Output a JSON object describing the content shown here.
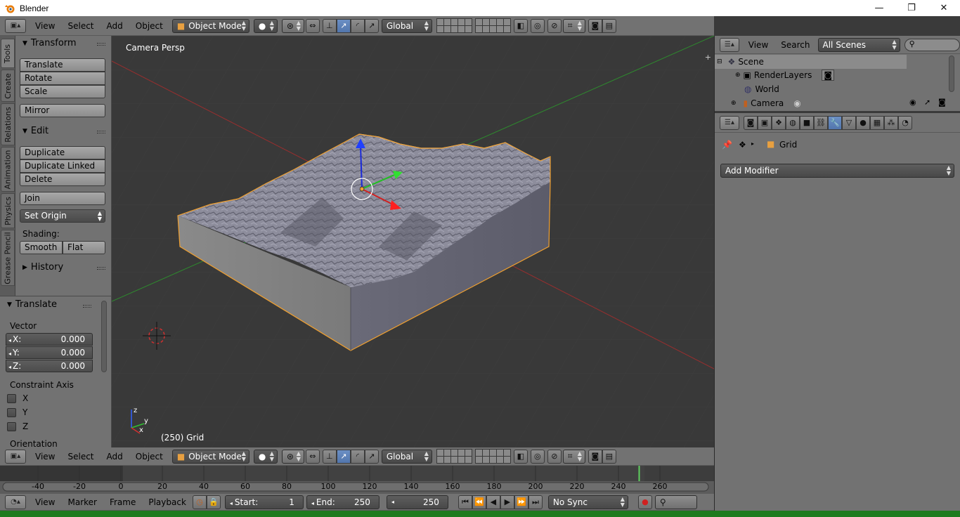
{
  "window": {
    "title": "Blender",
    "minimize": "—",
    "maximize": "❐",
    "close": "✕"
  },
  "top_header": {
    "menus": [
      "View",
      "Select",
      "Add",
      "Object"
    ],
    "mode": "Object Mode",
    "orientation": "Global"
  },
  "tool_tabs": [
    "Tools",
    "Create",
    "Relations",
    "Animation",
    "Physics",
    "Grease Pencil"
  ],
  "tool_shelf": {
    "transform_title": "Transform",
    "translate": "Translate",
    "rotate": "Rotate",
    "scale": "Scale",
    "mirror": "Mirror",
    "edit_title": "Edit",
    "duplicate": "Duplicate",
    "duplicate_linked": "Duplicate Linked",
    "delete": "Delete",
    "join": "Join",
    "set_origin": "Set Origin",
    "shading_label": "Shading:",
    "smooth": "Smooth",
    "flat": "Flat",
    "history_title": "History"
  },
  "operator_panel": {
    "title": "Translate",
    "vector_label": "Vector",
    "x_label": "X:",
    "x_value": "0.000",
    "y_label": "Y:",
    "y_value": "0.000",
    "z_label": "Z:",
    "z_value": "0.000",
    "constraint_label": "Constraint Axis",
    "cx": "X",
    "cy": "Y",
    "cz": "Z",
    "orientation_label": "Orientation"
  },
  "viewport": {
    "view_name": "Camera Persp",
    "frame_object": "(250) Grid",
    "axis_x": "x",
    "axis_y": "y",
    "axis_z": "z"
  },
  "outliner": {
    "menus": [
      "View",
      "Search"
    ],
    "scenes": "All Scenes",
    "items": [
      "Scene",
      "RenderLayers",
      "World",
      "Camera"
    ]
  },
  "properties": {
    "object_name": "Grid",
    "add_modifier": "Add Modifier"
  },
  "bottom_header": {
    "menus": [
      "View",
      "Select",
      "Add",
      "Object"
    ],
    "mode": "Object Mode",
    "orientation": "Global"
  },
  "timeline": {
    "ticks": [
      "-40",
      "-20",
      "0",
      "20",
      "40",
      "60",
      "80",
      "100",
      "120",
      "140",
      "160",
      "180",
      "200",
      "220",
      "240",
      "260"
    ],
    "current_frame_marker": 250,
    "menus": [
      "View",
      "Marker",
      "Frame",
      "Playback"
    ],
    "start_label": "Start:",
    "start_value": "1",
    "end_label": "End:",
    "end_value": "250",
    "current": "250",
    "sync": "No Sync"
  },
  "colors": {
    "viewport_bg": "#393939",
    "panel_bg": "#727272",
    "selection_outline": "#f0a030",
    "axis_x": "#b03030",
    "axis_y": "#30a030",
    "gizmo_z": "#2040ff",
    "status_green": "#1e7b1e"
  }
}
